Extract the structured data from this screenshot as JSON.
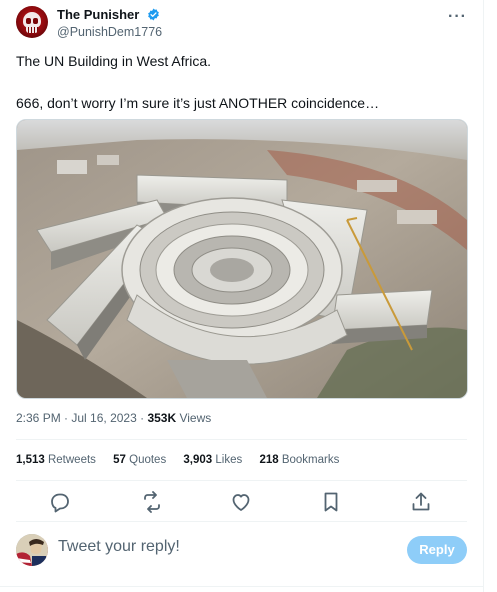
{
  "author": {
    "display_name": "The Punisher",
    "handle": "@PunishDem1776",
    "verified": true
  },
  "tweet": {
    "line1": "The UN Building in West Africa.",
    "line2": "666, don’t worry I’m sure it’s just ANOTHER coincidence…"
  },
  "meta": {
    "time": "2:36 PM",
    "separator": " · ",
    "date": "Jul 16, 2023",
    "views_count": "353K",
    "views_label": " Views"
  },
  "stats": {
    "retweets_count": "1,513",
    "retweets_label": "Retweets",
    "quotes_count": "57",
    "quotes_label": "Quotes",
    "likes_count": "3,903",
    "likes_label": "Likes",
    "bookmarks_count": "218",
    "bookmarks_label": "Bookmarks"
  },
  "reply": {
    "placeholder": "Tweet your reply!",
    "button_label": "Reply"
  },
  "icons": {
    "more": "more-icon",
    "verified": "verified-badge-icon",
    "reply": "reply-icon",
    "retweet": "retweet-icon",
    "like": "heart-icon",
    "bookmark": "bookmark-icon",
    "share": "share-icon"
  },
  "colors": {
    "accent": "#1d9bf0",
    "reply_button": "#8ecdf8",
    "secondary_text": "#536471",
    "primary_text": "#0f1419"
  }
}
